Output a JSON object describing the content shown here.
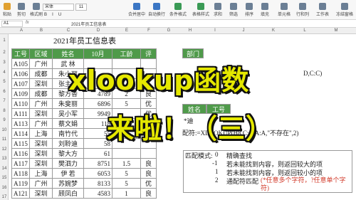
{
  "ribbon": {
    "font_name": "宋体",
    "font_size": "11",
    "buttons": [
      "粘贴",
      "剪切",
      "复制",
      "格式刷",
      "合并居中",
      "自动换行",
      "条件格式",
      "表格样式",
      "求和",
      "筛选",
      "排序",
      "填充",
      "单元格",
      "行和列",
      "工作表",
      "冻结窗格"
    ],
    "fmt": [
      "B",
      "I",
      "U"
    ]
  },
  "formula_bar": {
    "namebox": "A1",
    "fx": "fx",
    "content": "2021年员工信息表"
  },
  "columns": [
    "A",
    "B",
    "C",
    "D",
    "E",
    "F",
    "G",
    "H",
    "I",
    "J",
    "K",
    "L",
    "M"
  ],
  "rows": [
    "1",
    "2",
    "3",
    "4",
    "5",
    "6",
    "7",
    "8",
    "9",
    "10",
    "11",
    "12",
    "13",
    "14",
    "15",
    "16",
    "17"
  ],
  "table": {
    "title": "2021年员工信息表",
    "headers": [
      "工号",
      "区域",
      "姓名",
      "10月",
      "工龄",
      "评"
    ],
    "rows": [
      [
        "A105",
        "广州",
        "武  林",
        "",
        "",
        ""
      ],
      [
        "A106",
        "成都",
        "朱小丽",
        "",
        "",
        ""
      ],
      [
        "A107",
        "深圳",
        "张主通",
        "",
        "",
        ""
      ],
      [
        "A109",
        "成都",
        "黎方香",
        "4789",
        "2",
        "良"
      ],
      [
        "A110",
        "广州",
        "朱斐丽",
        "6896",
        "5",
        "优"
      ],
      [
        "A111",
        "深圳",
        "吴小军",
        "9949",
        "",
        "优"
      ],
      [
        "A113",
        "广州",
        "蔡文娟",
        "118",
        "",
        ""
      ],
      [
        "A114",
        "上海",
        "南竹代",
        "55",
        "",
        ""
      ],
      [
        "A115",
        "深圳",
        "刘聆迪",
        "58",
        "",
        ""
      ],
      [
        "A116",
        "深圳",
        "黎大方",
        "61",
        "",
        ""
      ],
      [
        "A117",
        "深圳",
        "樊泗力",
        "8751",
        "1.5",
        "良"
      ],
      [
        "A118",
        "上海",
        "伊  若",
        "6053",
        "5",
        "良"
      ],
      [
        "A119",
        "广州",
        "苏婉梦",
        "8133",
        "5",
        "优"
      ],
      [
        "A121",
        "深圳",
        "顾凤白",
        "4583",
        "1",
        "良"
      ]
    ]
  },
  "right": {
    "top_header": "部门",
    "formula_top": "D,C:C)",
    "lookup_headers": [
      "姓名",
      "工号"
    ],
    "lookup_name": "*迪",
    "formula_bottom": "配符:=XLOOKUP(H8,C:C,A:A,\"不存在\",2)",
    "mode_label": "匹配模式:",
    "modes": [
      {
        "code": "0",
        "desc": "精确查找"
      },
      {
        "code": "-1",
        "desc": "若未能找到内容，则返回较大的项"
      },
      {
        "code": "1",
        "desc": "若未能找到内容，则返回较小的项"
      },
      {
        "code": "2",
        "desc": "通配符匹配",
        "note": "(*任意多个字符，?任意单个字符)"
      }
    ]
  },
  "overlay": {
    "line1": "xlookup函数",
    "line2": "来啦！（三）"
  },
  "colors": {
    "header_green": "#4f9a4a",
    "overlay_yellow": "#e5e800",
    "note_red": "#d23a2a"
  }
}
